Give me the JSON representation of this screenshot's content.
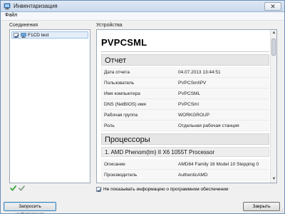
{
  "window": {
    "title": "Инвентаризация",
    "close_glyph": "✕"
  },
  "menu": {
    "file": "Файл"
  },
  "connections": {
    "label": "Соединения",
    "items": [
      {
        "name": "F1CD test",
        "checked": true
      }
    ]
  },
  "devices": {
    "label": "Устройства",
    "device_name": "PVPCSML",
    "report": {
      "title": "Отчет",
      "rows": [
        {
          "key": "Дата отчета",
          "value": "04.07.2013 13:44:51"
        },
        {
          "key": "Пользователь",
          "value": "PVPCSml\\PV"
        },
        {
          "key": "Имя компьютера",
          "value": "PVPCSML"
        },
        {
          "key": "DNS (NetBIOS) имя",
          "value": "PVPCSml"
        },
        {
          "key": "Рабочая группа",
          "value": "WORKGROUP"
        },
        {
          "key": "Роль",
          "value": "Отдельная рабочая станция"
        }
      ]
    },
    "processors": {
      "title": "Процессоры",
      "items": [
        {
          "name": "1. AMD Phenom(tm) II X6 1055T Processor",
          "rows": [
            {
              "key": "Описание",
              "value": "AMD64 Family 16 Model 10 Stepping 0"
            },
            {
              "key": "Производитель",
              "value": "AuthenticAMD"
            }
          ]
        }
      ]
    }
  },
  "options": {
    "hide_software_label": "Не показывать информацию о программном обеспечении",
    "hide_software_checked": true
  },
  "buttons": {
    "request_info": "Запросить информацию",
    "close": "Закрыть"
  },
  "colors": {
    "accent_check": "#3aa53a",
    "selection": "#e4eefa"
  },
  "icons": {
    "app": "inventory-app-icon",
    "connection": "computer-icon",
    "check_a": "green-check-icon",
    "check_b": "gray-check-icon"
  }
}
